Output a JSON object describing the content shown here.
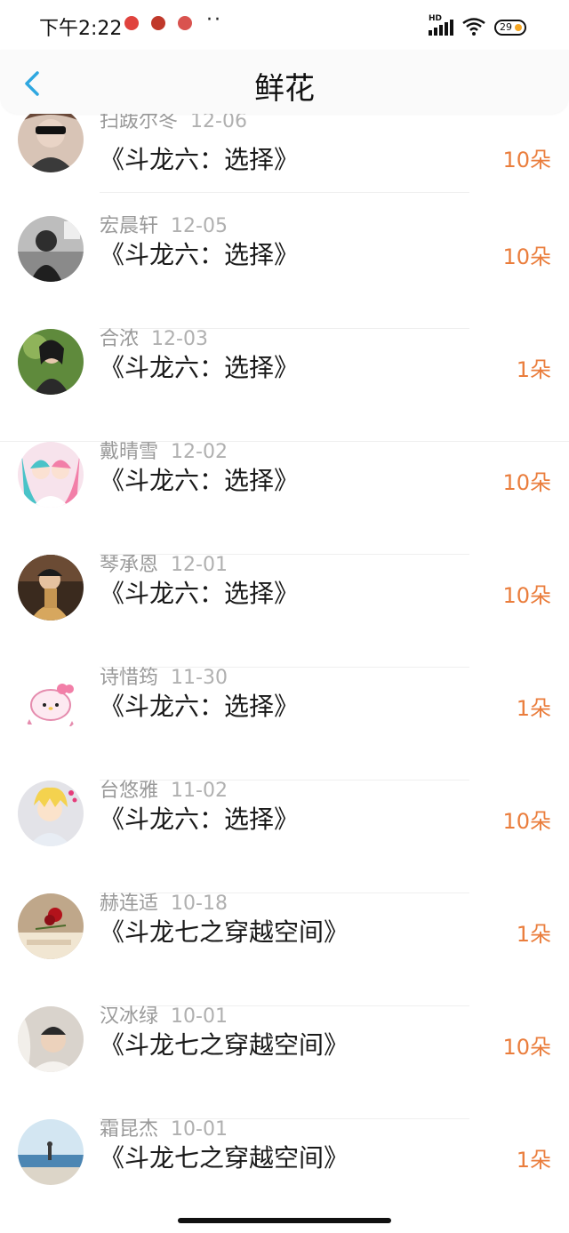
{
  "status_bar": {
    "time": "下午2:22",
    "signal_label": "HD",
    "battery": "29",
    "notif_colors": [
      "#e0433e",
      "#c0392b",
      "#d9534f"
    ]
  },
  "header": {
    "title": "鲜花",
    "back_icon": "chevron-left-icon",
    "accent_color": "#2ea7e0"
  },
  "records": [
    {
      "name": "扫跋尔冬",
      "date": "12-06",
      "book": "《斗龙六：选择》",
      "count": "10朵"
    },
    {
      "name": "宏晨轩",
      "date": "12-05",
      "book": "《斗龙六：选择》",
      "count": "10朵"
    },
    {
      "name": "合浓",
      "date": "12-03",
      "book": "《斗龙六：选择》",
      "count": "1朵"
    },
    {
      "name": "戴晴雪",
      "date": "12-02",
      "book": "《斗龙六：选择》",
      "count": "10朵"
    },
    {
      "name": "琴承恩",
      "date": "12-01",
      "book": "《斗龙六：选择》",
      "count": "10朵"
    },
    {
      "name": "诗惜筠",
      "date": "11-30",
      "book": "《斗龙六：选择》",
      "count": "1朵"
    },
    {
      "name": "台悠雅",
      "date": "11-02",
      "book": "《斗龙六：选择》",
      "count": "10朵"
    },
    {
      "name": "赫连适",
      "date": "10-18",
      "book": "《斗龙七之穿越空间》",
      "count": "1朵"
    },
    {
      "name": "汉冰绿",
      "date": "10-01",
      "book": "《斗龙七之穿越空间》",
      "count": "10朵"
    },
    {
      "name": "霜昆杰",
      "date": "10-01",
      "book": "《斗龙七之穿越空间》",
      "count": "1朵"
    }
  ],
  "colors": {
    "count": "#ea7d3c",
    "meta": "#9a9a9a"
  }
}
